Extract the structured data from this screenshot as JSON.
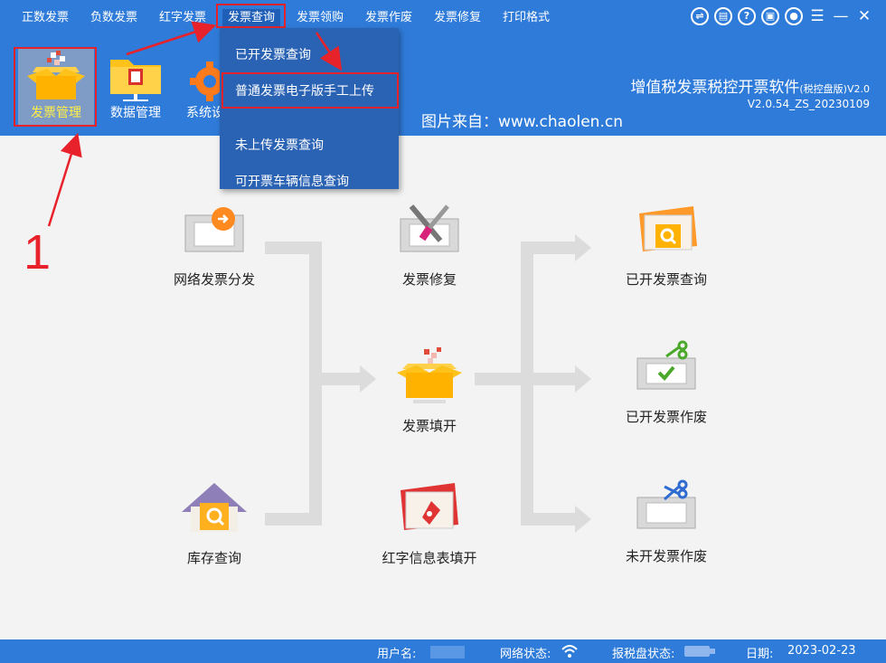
{
  "menu": [
    "正数发票",
    "负数发票",
    "红字发票",
    "发票查询",
    "发票领购",
    "发票作废",
    "发票修复",
    "打印格式"
  ],
  "toolbar": [
    "发票管理",
    "数据管理",
    "系统设"
  ],
  "app": {
    "title": "增值税发票税控开票软件",
    "title_suffix": "(税控盘版)V2.0",
    "version": "V2.0.54_ZS_20230109",
    "source": "图片来自：www.chaolen.cn"
  },
  "dropdown": [
    "已开发票查询",
    "普通发票电子版手工上传",
    "未上传发票查询",
    "可开票车辆信息查询"
  ],
  "annotation_number": "1",
  "functions": {
    "network_distribution": "网络发票分发",
    "inventory_query": "库存查询",
    "invoice_repair": "发票修复",
    "invoice_fill": "发票填开",
    "red_info_form": "红字信息表填开",
    "issued_query": "已开发票查询",
    "issued_void": "已开发票作废",
    "unissued_void": "未开发票作废"
  },
  "status": {
    "user_label": "用户名:",
    "network_label": "网络状态:",
    "disk_label": "报税盘状态:",
    "date_label": "日期:",
    "date": "2023-02-23"
  },
  "colors": {
    "header": "#2f7bd9",
    "dropdown": "#2b63b4",
    "highlight": "#e8222a",
    "flow_line": "#dcdcdc"
  }
}
